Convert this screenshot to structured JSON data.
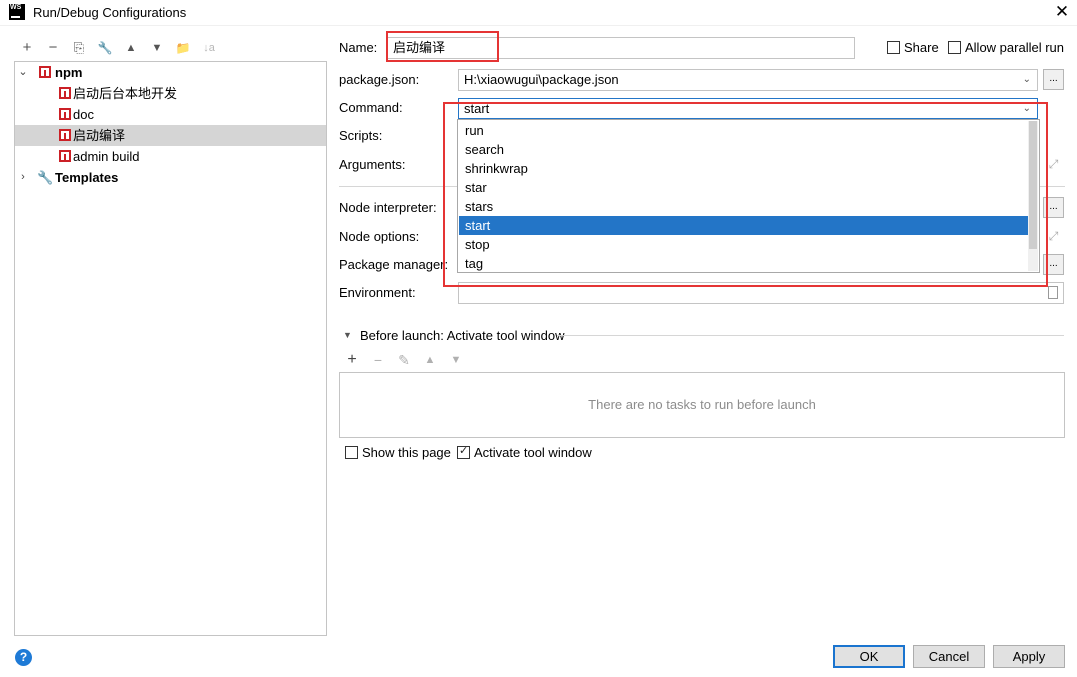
{
  "window": {
    "title": "Run/Debug Configurations",
    "app_icon_text": "WS",
    "close_glyph": "✕"
  },
  "left_toolbar": {
    "add": "+",
    "remove": "−",
    "copy": "⎘",
    "edit_defaults": "🔧",
    "move_up": "▲",
    "move_down": "▼",
    "new_folder": "📁",
    "sort": "↓a"
  },
  "tree": {
    "group": {
      "label": "npm",
      "expanded": true
    },
    "items": [
      {
        "label": "启动后台本地开发",
        "selected": false
      },
      {
        "label": "doc",
        "selected": false
      },
      {
        "label": "启动编译",
        "selected": true
      },
      {
        "label": "admin build",
        "selected": false
      }
    ],
    "templates": {
      "label": "Templates",
      "expanded": false
    }
  },
  "form": {
    "name_label": "Name:",
    "name_value": "启动编译",
    "share_label": "Share",
    "share_checked": false,
    "parallel_label": "Allow parallel run",
    "parallel_checked": false,
    "package_json_label": "package.json:",
    "package_json_value": "H:\\xiaowugui\\package.json",
    "command_label": "Command:",
    "command_value": "start",
    "scripts_label": "Scripts:",
    "arguments_label": "Arguments:",
    "node_interpreter_label": "Node interpreter:",
    "node_options_label": "Node options:",
    "package_manager_label": "Package manager:",
    "environment_label": "Environment:",
    "browse_label": "...",
    "expand_glyph": "⤢"
  },
  "command_dropdown": {
    "options": [
      "run",
      "search",
      "shrinkwrap",
      "star",
      "stars",
      "start",
      "stop",
      "tag"
    ],
    "selected": "start"
  },
  "before_launch": {
    "header": "Before launch: Activate tool window",
    "empty_text": "There are no tasks to run before launch",
    "toolbar": {
      "add": "+",
      "remove": "−",
      "edit": "✎",
      "up": "▲",
      "down": "▼"
    },
    "show_page_label": "Show this page",
    "show_page_checked": false,
    "activate_label": "Activate tool window",
    "activate_checked": true
  },
  "buttons": {
    "ok": "OK",
    "cancel": "Cancel",
    "apply": "Apply",
    "help": "?"
  },
  "colors": {
    "selection_blue": "#2375c7",
    "annotation_red": "#e53434",
    "npm_red": "#cb2026",
    "tree_selected_gray": "#d5d5d5"
  }
}
